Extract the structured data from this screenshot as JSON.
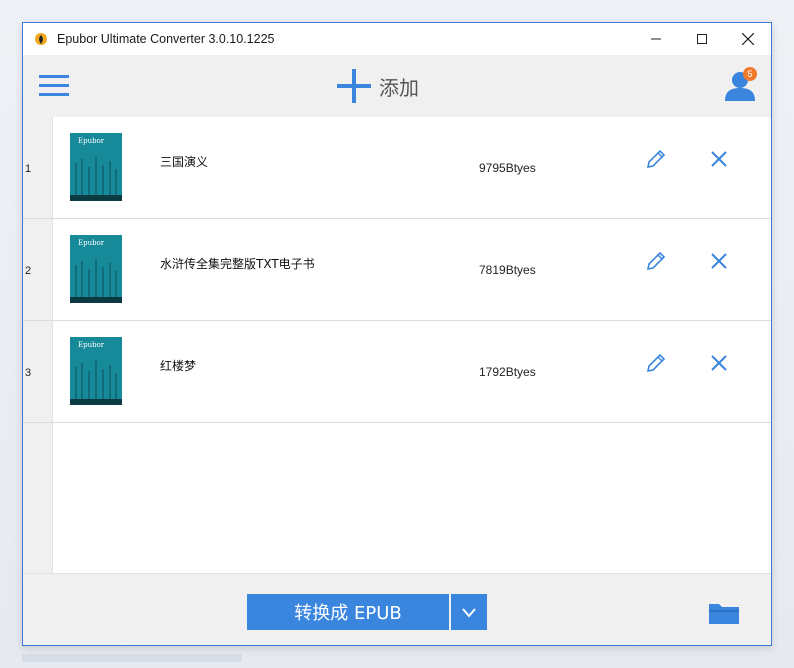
{
  "window": {
    "title": "Epubor Ultimate Converter 3.0.10.1225"
  },
  "toolbar": {
    "add_label": "添加",
    "notification_count": "5"
  },
  "books": [
    {
      "index": "1",
      "name": "三国演义",
      "size": "9795Btyes"
    },
    {
      "index": "2",
      "name": "水浒传全集完整版TXT电子书",
      "size": "7819Btyes"
    },
    {
      "index": "3",
      "name": "红楼梦",
      "size": "1792Btyes"
    }
  ],
  "cover_logo_text": "Epubor",
  "bottom": {
    "convert_label": "转换成 EPUB"
  },
  "colors": {
    "accent": "#3a86df",
    "cover": "#178a9a",
    "badge": "#f07a2c"
  }
}
